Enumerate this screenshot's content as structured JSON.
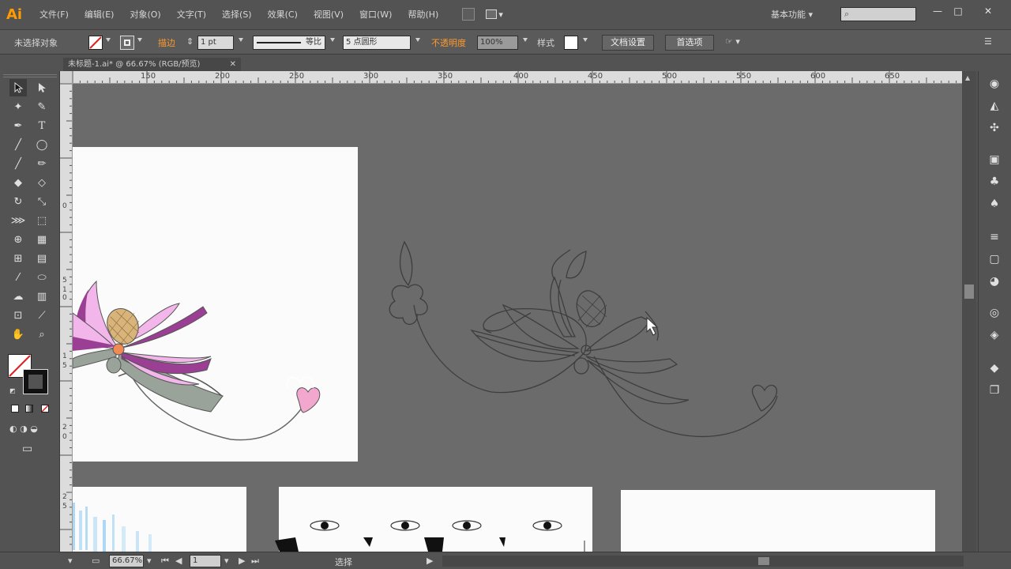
{
  "app": {
    "logo": "Ai",
    "menus": [
      "文件(F)",
      "编辑(E)",
      "对象(O)",
      "文字(T)",
      "选择(S)",
      "效果(C)",
      "视图(V)",
      "窗口(W)",
      "帮助(H)"
    ],
    "workspace_label": "基本功能",
    "search_placeholder": "",
    "window_buttons": [
      "—",
      "□",
      "✕"
    ]
  },
  "control_bar": {
    "selection_label": "未选择对象",
    "stroke_label": "描边",
    "stroke_value": "1 pt",
    "stroke_style": "等比",
    "brush_value": "5 点圆形",
    "opacity_label": "不透明度",
    "opacity_value": "100%",
    "style_label": "样式",
    "doc_setup_button": "文档设置",
    "preferences_button": "首选项"
  },
  "document": {
    "tab_title": "未标题-1.ai* @ 66.67% (RGB/预览)",
    "close": "✕"
  },
  "ruler": {
    "h_labels": [
      "150",
      "200",
      "250",
      "300",
      "350",
      "400",
      "450",
      "500",
      "550",
      "600",
      "650"
    ],
    "v_labels": [
      "0",
      "5",
      "1",
      "0",
      "1",
      "5",
      "2",
      "0",
      "2",
      "5"
    ]
  },
  "status": {
    "zoom": "66.67%",
    "page": "1",
    "tool_label": "选择"
  },
  "colors": {
    "accent": "#ff9a00",
    "petal_pink": "#f3b6ea",
    "petal_purple": "#9b3f95",
    "leaf_green": "#9aa39a",
    "seed_yellow": "#d8b47a",
    "center_orange": "#f08a55",
    "heart_pink": "#f2a7cf",
    "canvas_gray": "#6b6b6b"
  },
  "icons": {
    "tools": [
      "selection-icon",
      "direct-selection-icon",
      "magic-wand-icon",
      "lasso-icon",
      "pen-icon",
      "type-icon",
      "line-icon",
      "ellipse-icon",
      "paintbrush-icon",
      "pencil-icon",
      "blob-brush-icon",
      "eraser-icon",
      "rotate-icon",
      "scale-icon",
      "warp-icon",
      "free-transform-icon",
      "shape-builder-icon",
      "perspective-grid-icon",
      "mesh-icon",
      "gradient-icon",
      "eyedropper-icon",
      "blend-icon",
      "symbol-sprayer-icon",
      "column-graph-icon",
      "artboard-icon",
      "slice-icon",
      "hand-icon",
      "zoom-icon"
    ],
    "right_panel": [
      "color-panel-icon",
      "color-guide-icon",
      "swatches-icon",
      "brushes-icon",
      "symbols-icon",
      "graphic-styles-icon",
      "stroke-icon",
      "gradient-panel-icon",
      "transparency-icon",
      "appearance-icon",
      "navigator-icon",
      "layers-icon",
      "artboards-icon"
    ]
  }
}
